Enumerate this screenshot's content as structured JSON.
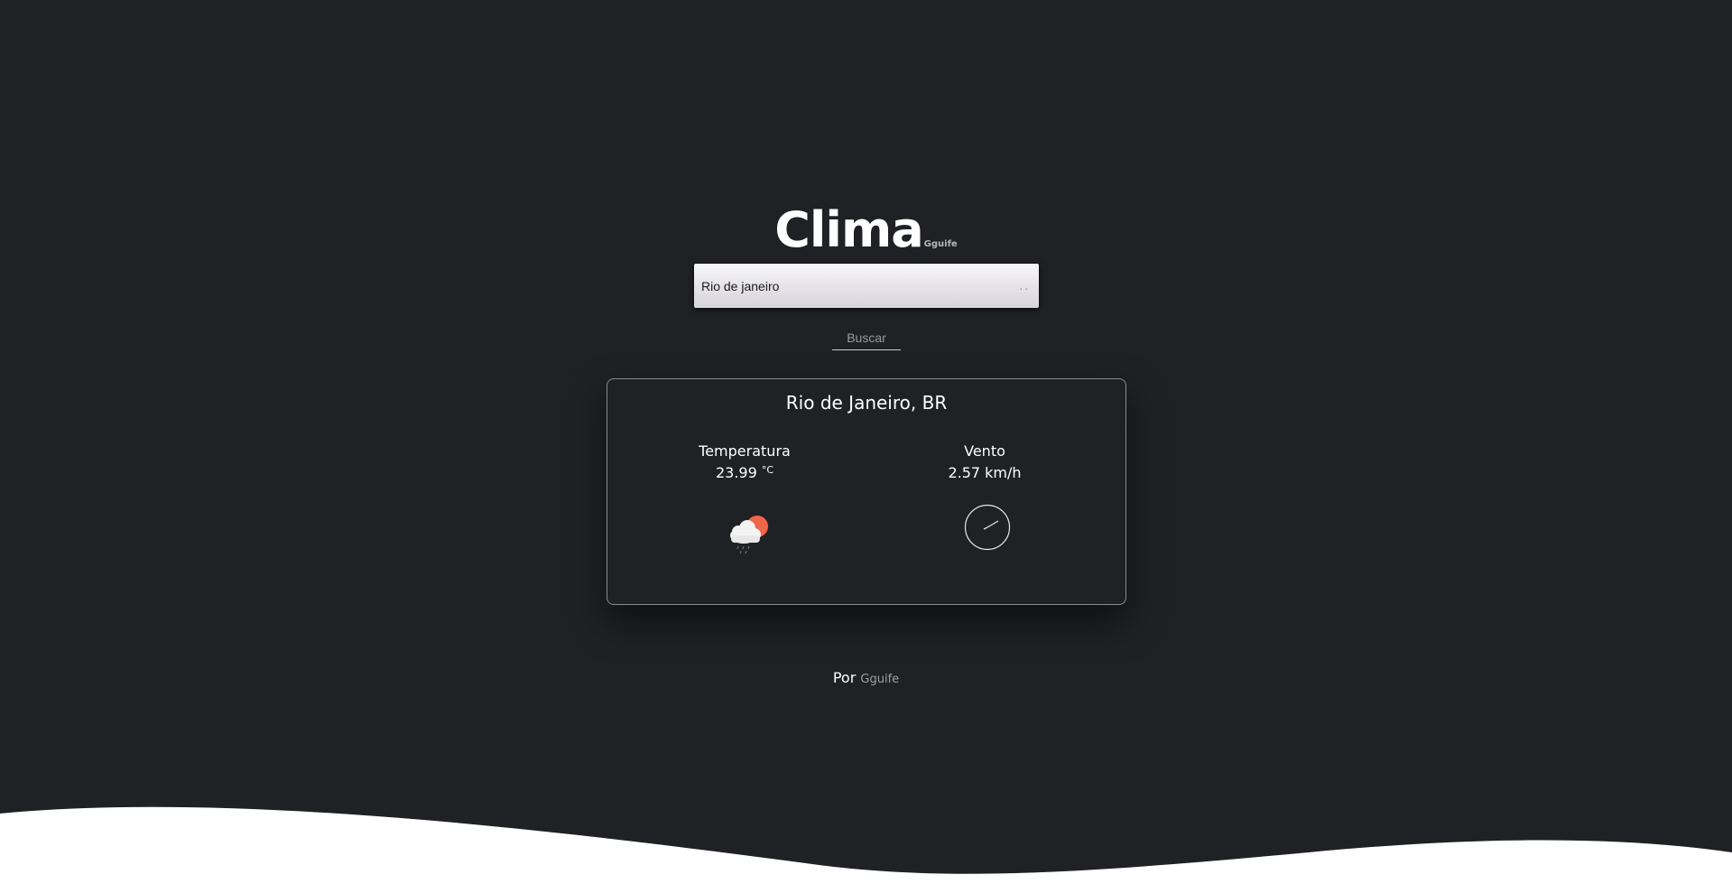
{
  "header": {
    "title": "Clima",
    "subtitle": "Gguife"
  },
  "search": {
    "value": "Rio de janeiro",
    "dots": "..",
    "button_label": "Buscar"
  },
  "card": {
    "city": "Rio de Janeiro, BR",
    "temperature": {
      "label": "Temperatura",
      "value": "23.99",
      "unit": "°C",
      "icon": "rain-cloud-sun-icon"
    },
    "wind": {
      "label": "Vento",
      "value": "2.57 km/h",
      "icon": "wind-direction-icon"
    }
  },
  "footer": {
    "by": "Por",
    "author": "Gguife"
  },
  "colors": {
    "background": "#202125",
    "sun": "#f0664a",
    "wave": "#ffffff"
  }
}
